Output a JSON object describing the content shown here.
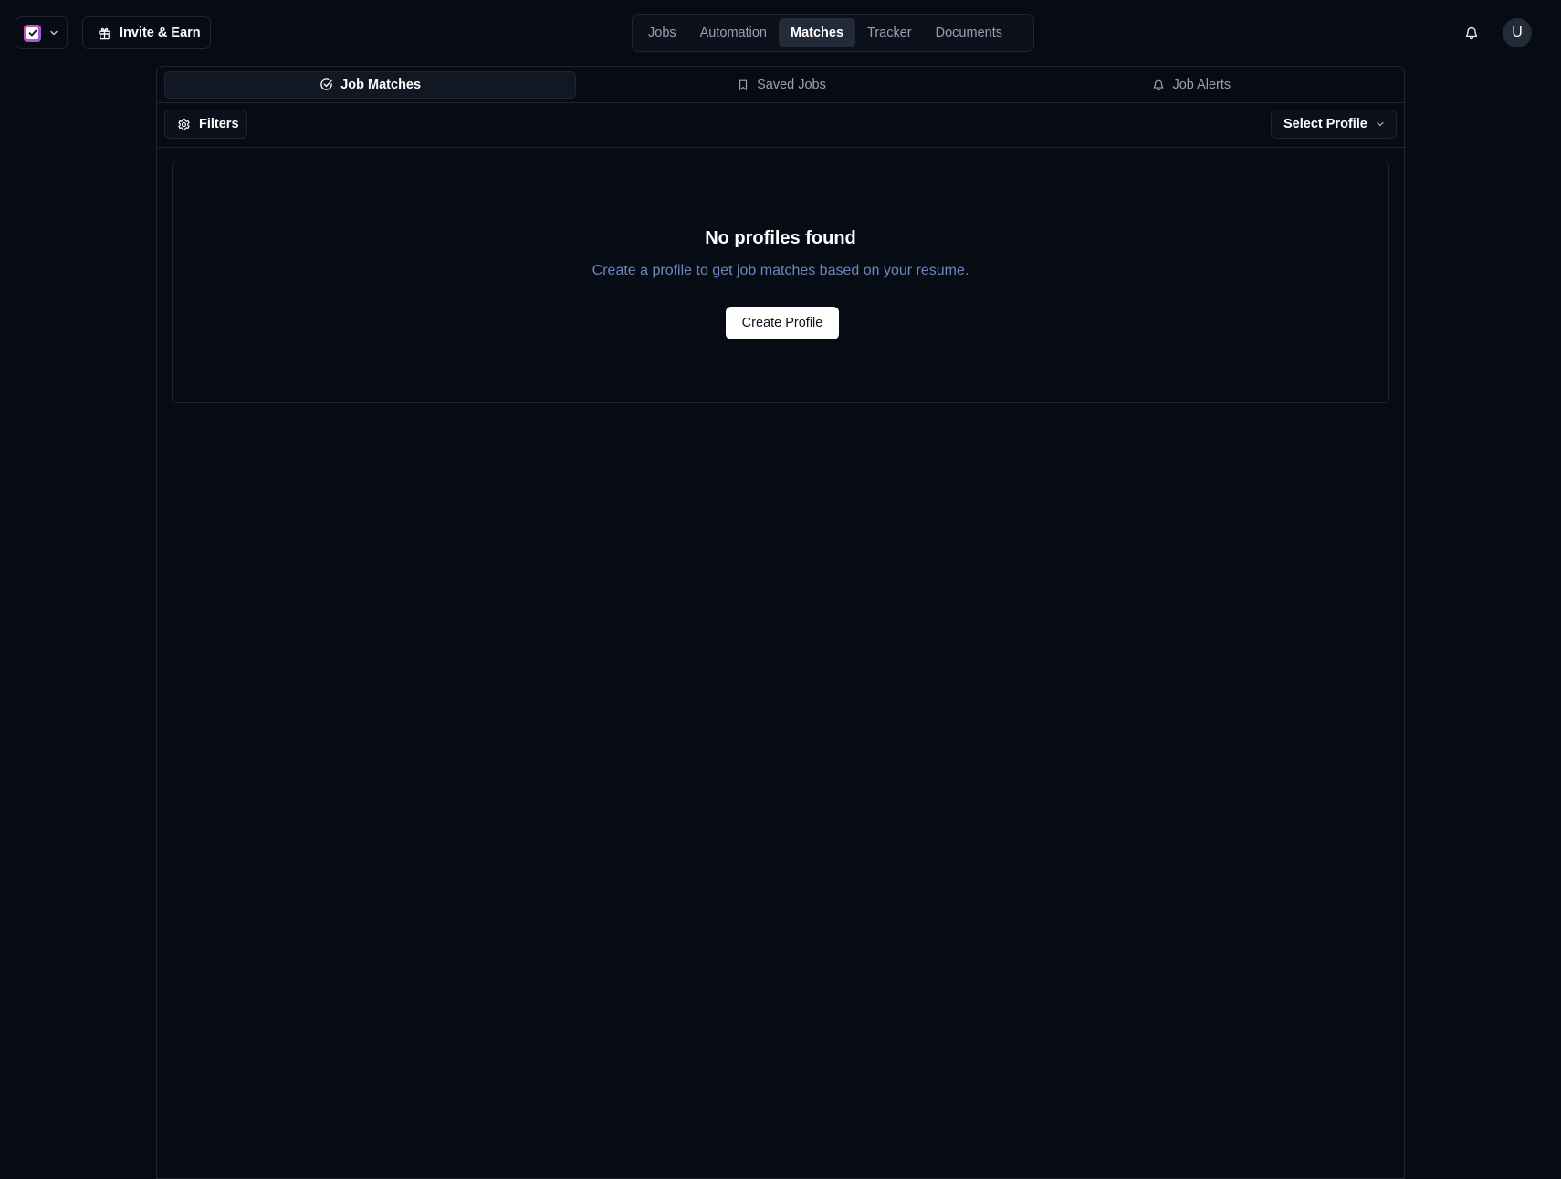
{
  "header": {
    "invite_label": "Invite & Earn",
    "nav_tabs": [
      {
        "label": "Jobs",
        "active": false
      },
      {
        "label": "Automation",
        "active": false
      },
      {
        "label": "Matches",
        "active": true
      },
      {
        "label": "Tracker",
        "active": false
      },
      {
        "label": "Documents",
        "active": false
      }
    ],
    "avatar_initial": "U"
  },
  "subtabs": [
    {
      "label": "Job Matches",
      "icon": "check-circle-icon",
      "active": true
    },
    {
      "label": "Saved Jobs",
      "icon": "bookmark-icon",
      "active": false
    },
    {
      "label": "Job Alerts",
      "icon": "bell-icon",
      "active": false
    }
  ],
  "toolbar": {
    "filters_label": "Filters",
    "profile_select_value": "Select Profile"
  },
  "empty_state": {
    "title": "No profiles found",
    "description": "Create a profile to get job matches based on your resume.",
    "button_label": "Create Profile"
  },
  "colors": {
    "background": "#070b14",
    "border": "#1f2533",
    "muted_text": "#98a1b3",
    "description_text": "#6e86bd",
    "active_tab_bg": "#232a38"
  }
}
